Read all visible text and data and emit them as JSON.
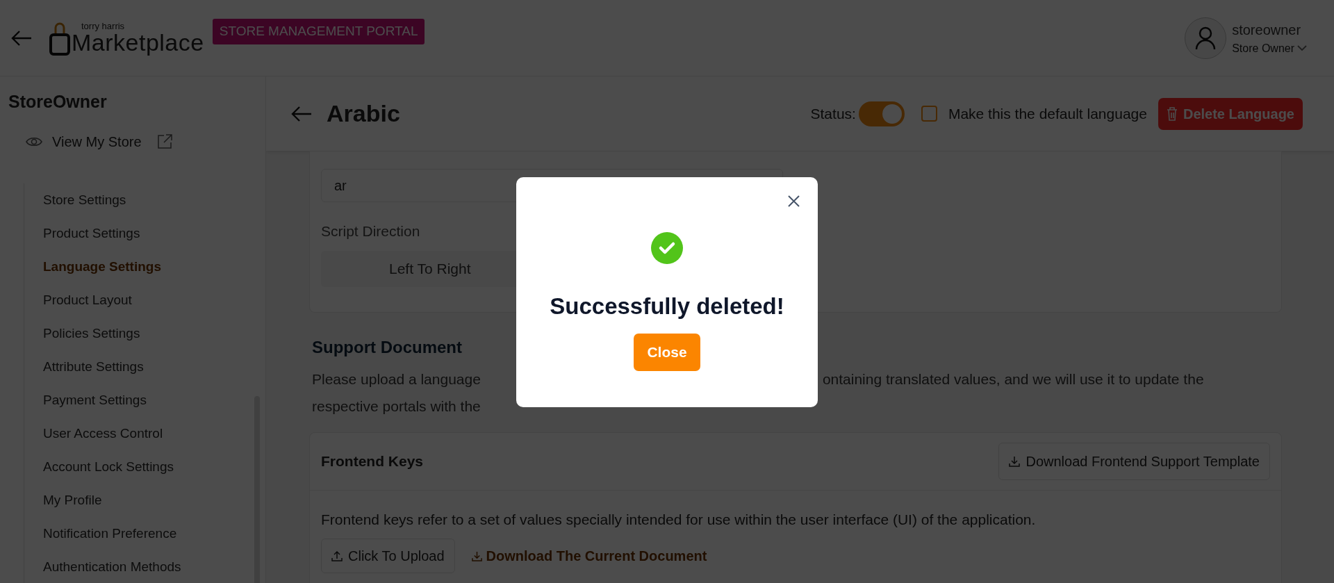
{
  "header": {
    "logo": {
      "tagline": "torry harris",
      "wordmark": "Marketplace"
    },
    "portal_badge": "STORE MANAGEMENT PORTAL",
    "user": {
      "name": "storeowner",
      "role": "Store Owner"
    }
  },
  "sidebar": {
    "title": "StoreOwner",
    "view_store": "View My Store",
    "items": [
      {
        "label": "Store Settings",
        "selected": false
      },
      {
        "label": "Product Settings",
        "selected": false
      },
      {
        "label": "Language Settings",
        "selected": true
      },
      {
        "label": "Product Layout",
        "selected": false
      },
      {
        "label": "Policies Settings",
        "selected": false
      },
      {
        "label": "Attribute Settings",
        "selected": false
      },
      {
        "label": "Payment Settings",
        "selected": false
      },
      {
        "label": "User Access Control",
        "selected": false
      },
      {
        "label": "Account Lock Settings",
        "selected": false
      },
      {
        "label": "My Profile",
        "selected": false
      },
      {
        "label": "Notification Preference",
        "selected": false
      },
      {
        "label": "Authentication Methods",
        "selected": false
      }
    ]
  },
  "page": {
    "title": "Arabic",
    "status": {
      "label": "Status:",
      "on": true
    },
    "default_language": {
      "label": "Make this the default language",
      "checked": false
    },
    "delete_button": "Delete Language"
  },
  "form": {
    "language_code_value": "ar",
    "script_direction_label": "Script Direction",
    "script_direction_value": "Left To Right"
  },
  "support": {
    "heading": "Support Document",
    "paragraph_fragments": [
      "Please upload a language",
      "ontaining translated values, and we will use it to update the",
      "respective portals with the"
    ],
    "frontend_keys": {
      "title": "Frontend Keys",
      "download_template": "Download Frontend Support Template",
      "description": "Frontend keys refer to a set of values specially intended for use within the user interface (UI) of the application.",
      "upload_button": "Click To Upload",
      "download_current": "Download The Current Document"
    }
  },
  "modal": {
    "message": "Successfully deleted!",
    "close_button": "Close"
  }
}
